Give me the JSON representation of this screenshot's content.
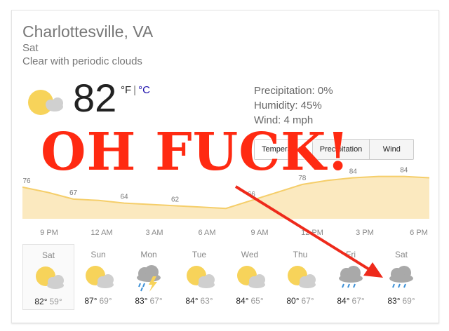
{
  "weather": {
    "location": "Charlottesville, VA",
    "day": "Sat",
    "condition": "Clear with periodic clouds",
    "temperature": "82",
    "unit_f": "°F",
    "unit_sep": "|",
    "unit_c": "°C",
    "precipitation": "Precipitation: 0%",
    "humidity": "Humidity: 45%",
    "wind": "Wind: 4 mph",
    "tabs": [
      "Temperature",
      "Precipitation",
      "Wind"
    ],
    "active_tab": "Temperature"
  },
  "chart_data": {
    "type": "area",
    "x": [
      "8 PM",
      "9 PM",
      "11 PM",
      "12 AM",
      "2 AM",
      "3 AM",
      "5 AM",
      "6 AM",
      "8 AM",
      "9 AM",
      "11 AM",
      "12 PM",
      "2 PM",
      "3 PM",
      "5 PM",
      "6 PM",
      "7 PM"
    ],
    "x_tick_labels": [
      "9 PM",
      "12 AM",
      "3 AM",
      "6 AM",
      "9 AM",
      "12 PM",
      "3 PM",
      "6 PM"
    ],
    "series": [
      {
        "values": [
          76,
          72,
          67,
          66,
          64,
          63,
          62,
          61,
          60,
          66,
          72,
          78,
          81,
          83,
          84,
          84,
          83
        ]
      }
    ],
    "value_labels": [
      76,
      67,
      64,
      62,
      66,
      78,
      84,
      84
    ],
    "fill_color": "#fbe9bf",
    "line_color": "#f5ce6a"
  },
  "forecast": [
    {
      "day": "Sat",
      "icon": "sun-cloud-icon",
      "hi": "82°",
      "lo": "59°"
    },
    {
      "day": "Sun",
      "icon": "sun-cloud-icon",
      "hi": "87°",
      "lo": "69°"
    },
    {
      "day": "Mon",
      "icon": "thunderstorm-icon",
      "hi": "83°",
      "lo": "67°"
    },
    {
      "day": "Tue",
      "icon": "sun-cloud-icon",
      "hi": "84°",
      "lo": "63°"
    },
    {
      "day": "Wed",
      "icon": "sun-cloud-icon",
      "hi": "84°",
      "lo": "65°"
    },
    {
      "day": "Thu",
      "icon": "sun-cloud-icon",
      "hi": "80°",
      "lo": "67°"
    },
    {
      "day": "Fri",
      "icon": "rain-icon",
      "hi": "84°",
      "lo": "67°"
    },
    {
      "day": "Sat",
      "icon": "rain-icon",
      "hi": "83°",
      "lo": "69°"
    }
  ],
  "overlay": {
    "text": "OH FUCK!",
    "color": "#ff2a12"
  }
}
